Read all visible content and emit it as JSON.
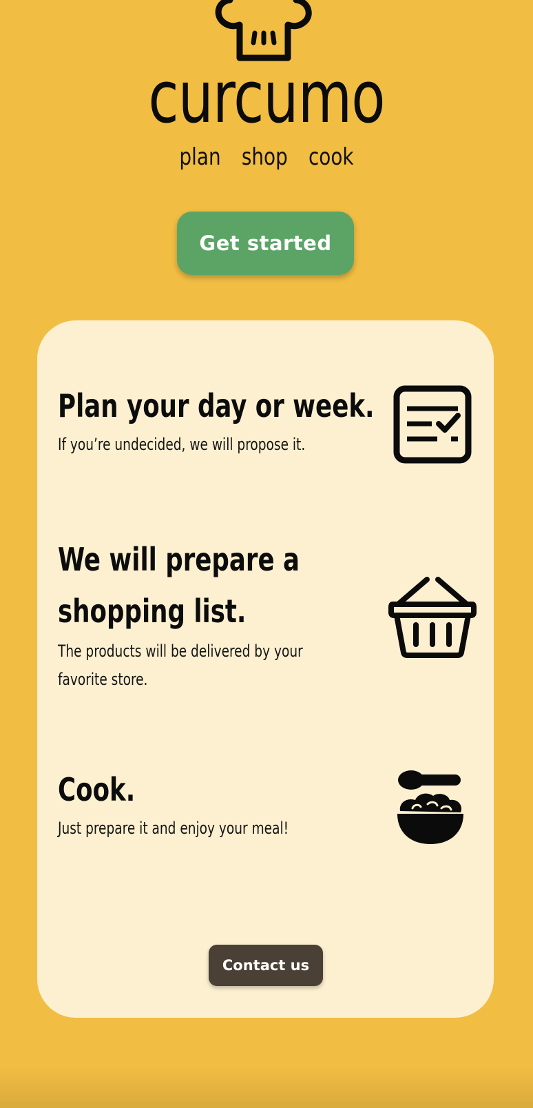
{
  "header": {
    "brand_name": "curcumo",
    "tagline": [
      "plan",
      "shop",
      "cook"
    ],
    "logo_icon": "chef-hat-icon",
    "cta_label": "Get started"
  },
  "features": [
    {
      "title": "Plan your day or week.",
      "text": "If you’re undecided, we will propose it.",
      "icon": "checklist-icon"
    },
    {
      "title": "We will prepare a shopping list.",
      "text": "The products will be delivered by your favorite store.",
      "icon": "shopping-basket-icon"
    },
    {
      "title": "Cook.",
      "text": "Just prepare it and enjoy your meal!",
      "icon": "bowl-spoon-icon"
    }
  ],
  "contact_label": "Contact us",
  "colors": {
    "background": "#f1bd43",
    "card": "#fdf0d1",
    "cta_button": "#5ba466",
    "contact_button": "#4a4035",
    "text": "#111111"
  }
}
